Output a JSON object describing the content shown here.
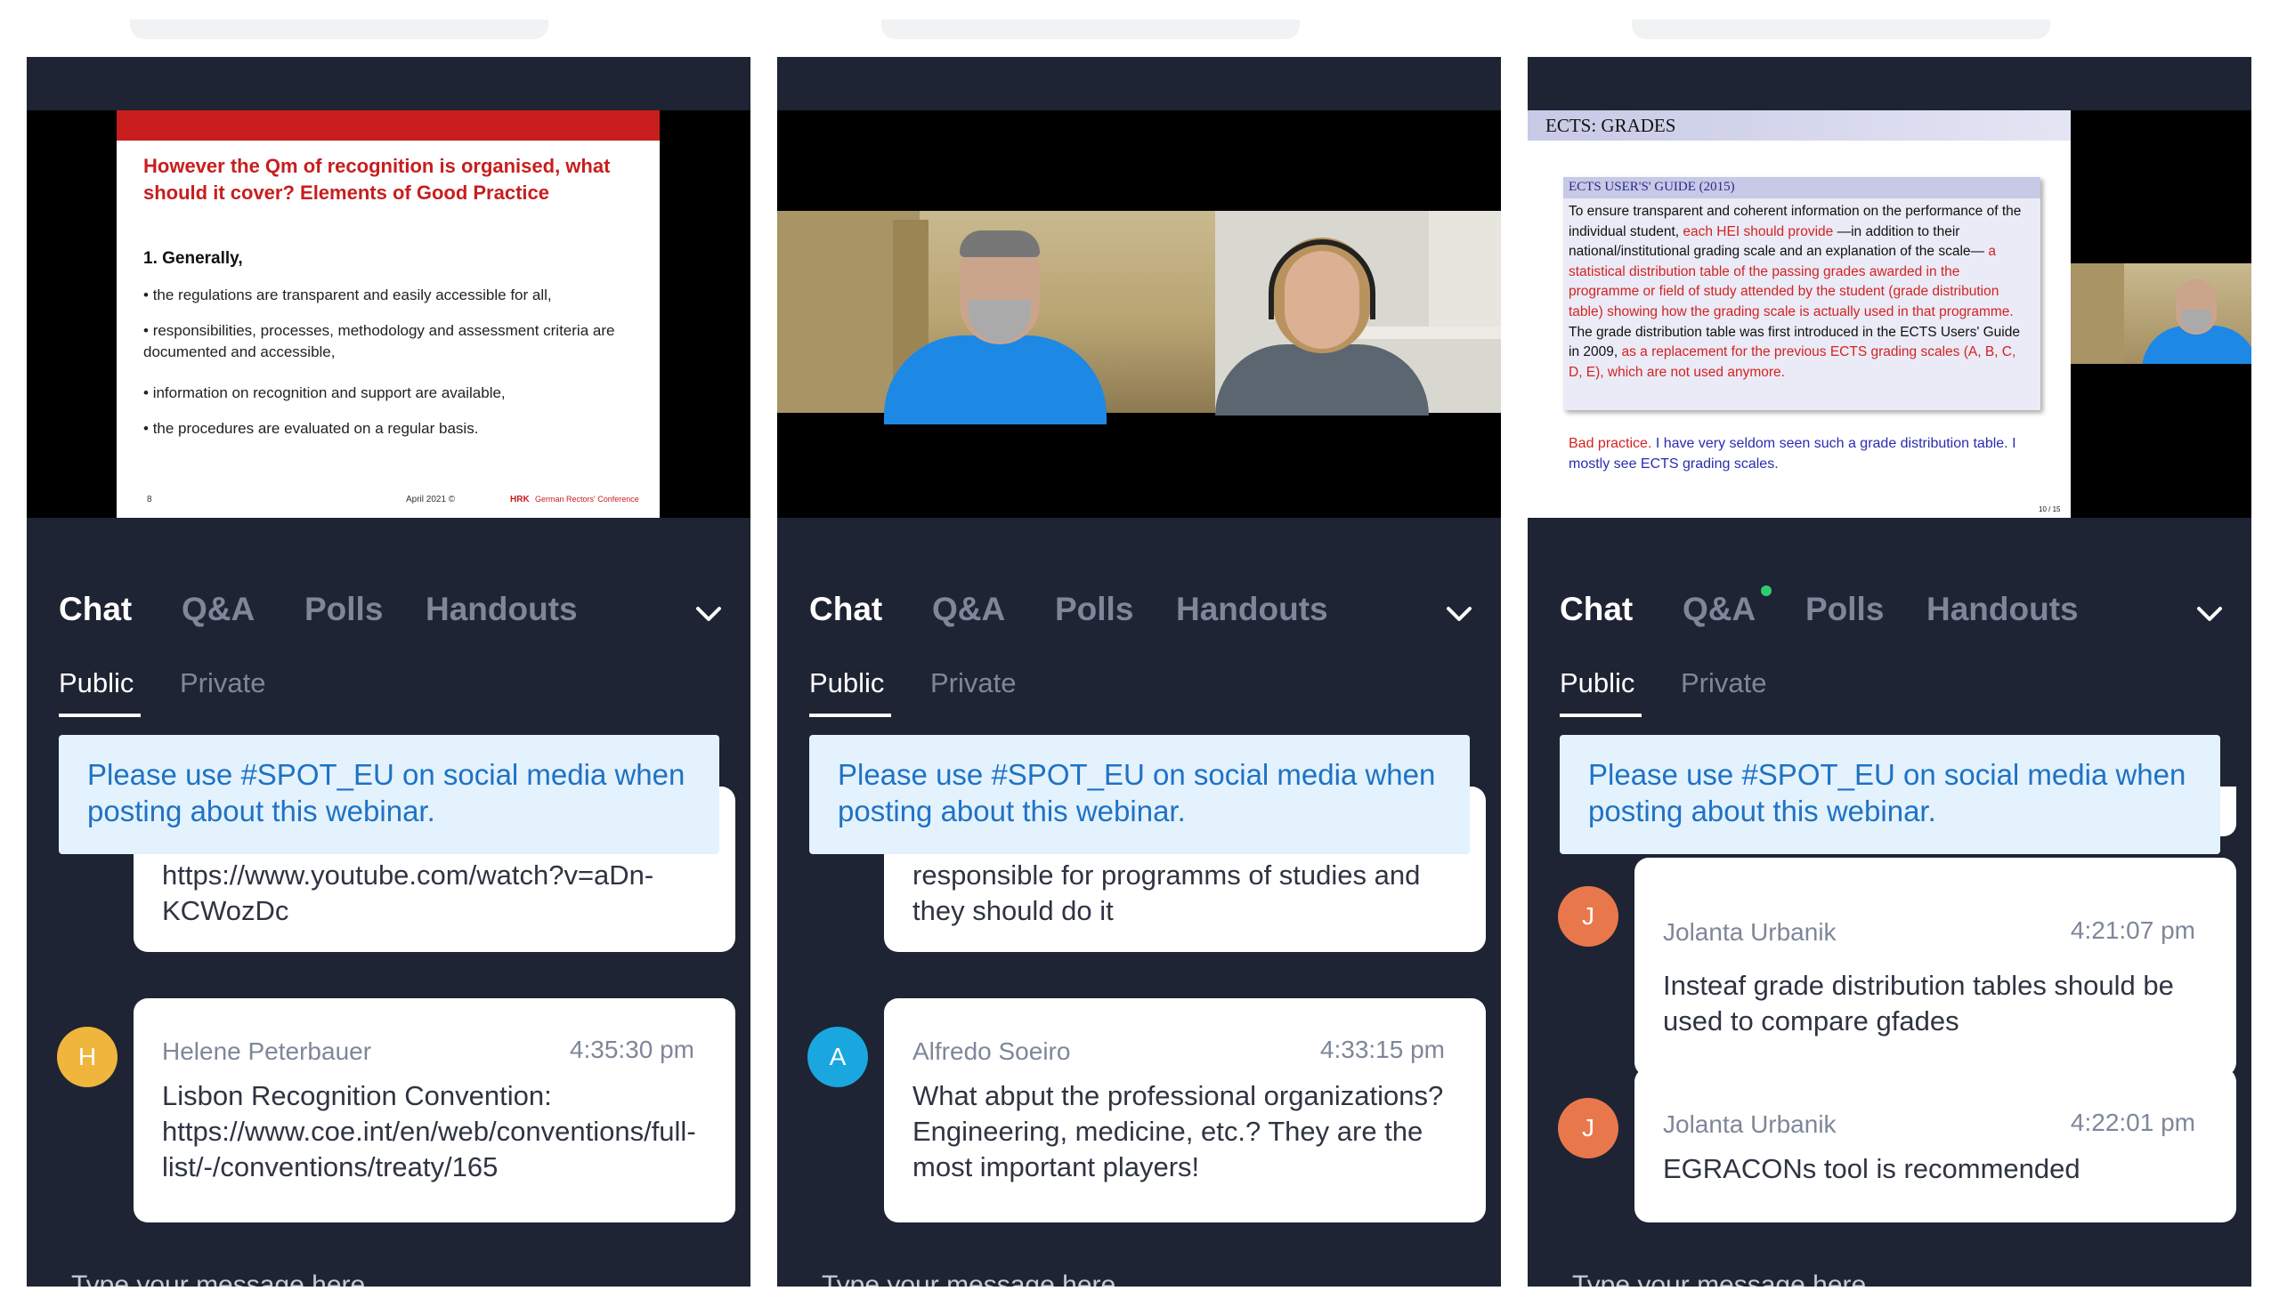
{
  "colors": {
    "panel_bg": "#1e2433",
    "accent_blue": "#1f72c4",
    "banner_bg": "#e3f2fd",
    "avatar_orange": "#e8784b",
    "avatar_yellow": "#f0b53c",
    "avatar_cyan": "#1aa7e0",
    "notice_dot": "#2ecc71",
    "slide_red": "#c81e1e"
  },
  "tabs": {
    "chat": "Chat",
    "qa": "Q&A",
    "polls": "Polls",
    "handouts": "Handouts"
  },
  "subtabs": {
    "public": "Public",
    "private": "Private"
  },
  "banner": {
    "text": "Please use #SPOT_EU on social media when posting about this webinar."
  },
  "compose": {
    "placeholder": "Type your message here"
  },
  "panel1": {
    "slide": {
      "title": "However the Qm of recognition is organised, what should it cover? Elements of Good Practice",
      "heading": "1. Generally,",
      "bullets": [
        "the regulations are transparent and easily accessible for all,",
        "responsibilities, processes, methodology and assessment criteria are documented and accessible,",
        "information on recognition and support are available,",
        "the procedures are evaluated on a regular basis."
      ],
      "page": "8",
      "date": "April 2021 ©",
      "org_abbr": "HRK",
      "org_name": "German Rectors' Conference"
    },
    "partial_message": "https://www.youtube.com/watch?v=aDn-KCWozDc",
    "message": {
      "avatar": "H",
      "name": "Helene Peterbauer",
      "time": "4:35:30 pm",
      "text": "Lisbon Recognition Convention: https://www.coe.int/en/web/conventions/full-list/-/conventions/treaty/165"
    }
  },
  "panel2": {
    "partial_message": "responsible for programms of studies and they should do it",
    "message": {
      "avatar": "A",
      "name": "Alfredo Soeiro",
      "time": "4:33:15 pm",
      "text": "What abput the professional organizations? Engineering, medicine, etc.? They are the most important players!"
    }
  },
  "panel3": {
    "slide": {
      "title": "ECTS: GRADES",
      "box_title": "ECTS USER'S' GUIDE (2015)",
      "p1": "To ensure transparent and coherent information on the performance of the individual student, ",
      "p2": "each HEI should provide",
      "p3": " —in addition to their national/institutional grading scale and an explanation of the scale— ",
      "p4": "a statistical distribution table of the passing grades awarded in the programme or field of study attended by the student (grade distribution table) showing how the grading scale is actually used in that programme.",
      "p5": " The grade distribution table was first introduced in the ECTS Users' Guide in 2009, ",
      "p6": "as a replacement for the previous ECTS grading scales (A, B, C, D, E), which are not used anymore.",
      "bad_label": "Bad practice.",
      "bad_text": " I have very seldom seen such a grade distribution table. I mostly see ECTS grading scales.",
      "page": "10 / 15"
    },
    "messages": [
      {
        "avatar": "J",
        "name": "Jolanta Urbanik",
        "time": "4:21:07 pm",
        "text": "Insteaf grade distribution tables should be used to compare gfades"
      },
      {
        "avatar": "J",
        "name": "Jolanta Urbanik",
        "time": "4:22:01 pm",
        "text": "EGRACONs tool is recommended"
      }
    ]
  }
}
